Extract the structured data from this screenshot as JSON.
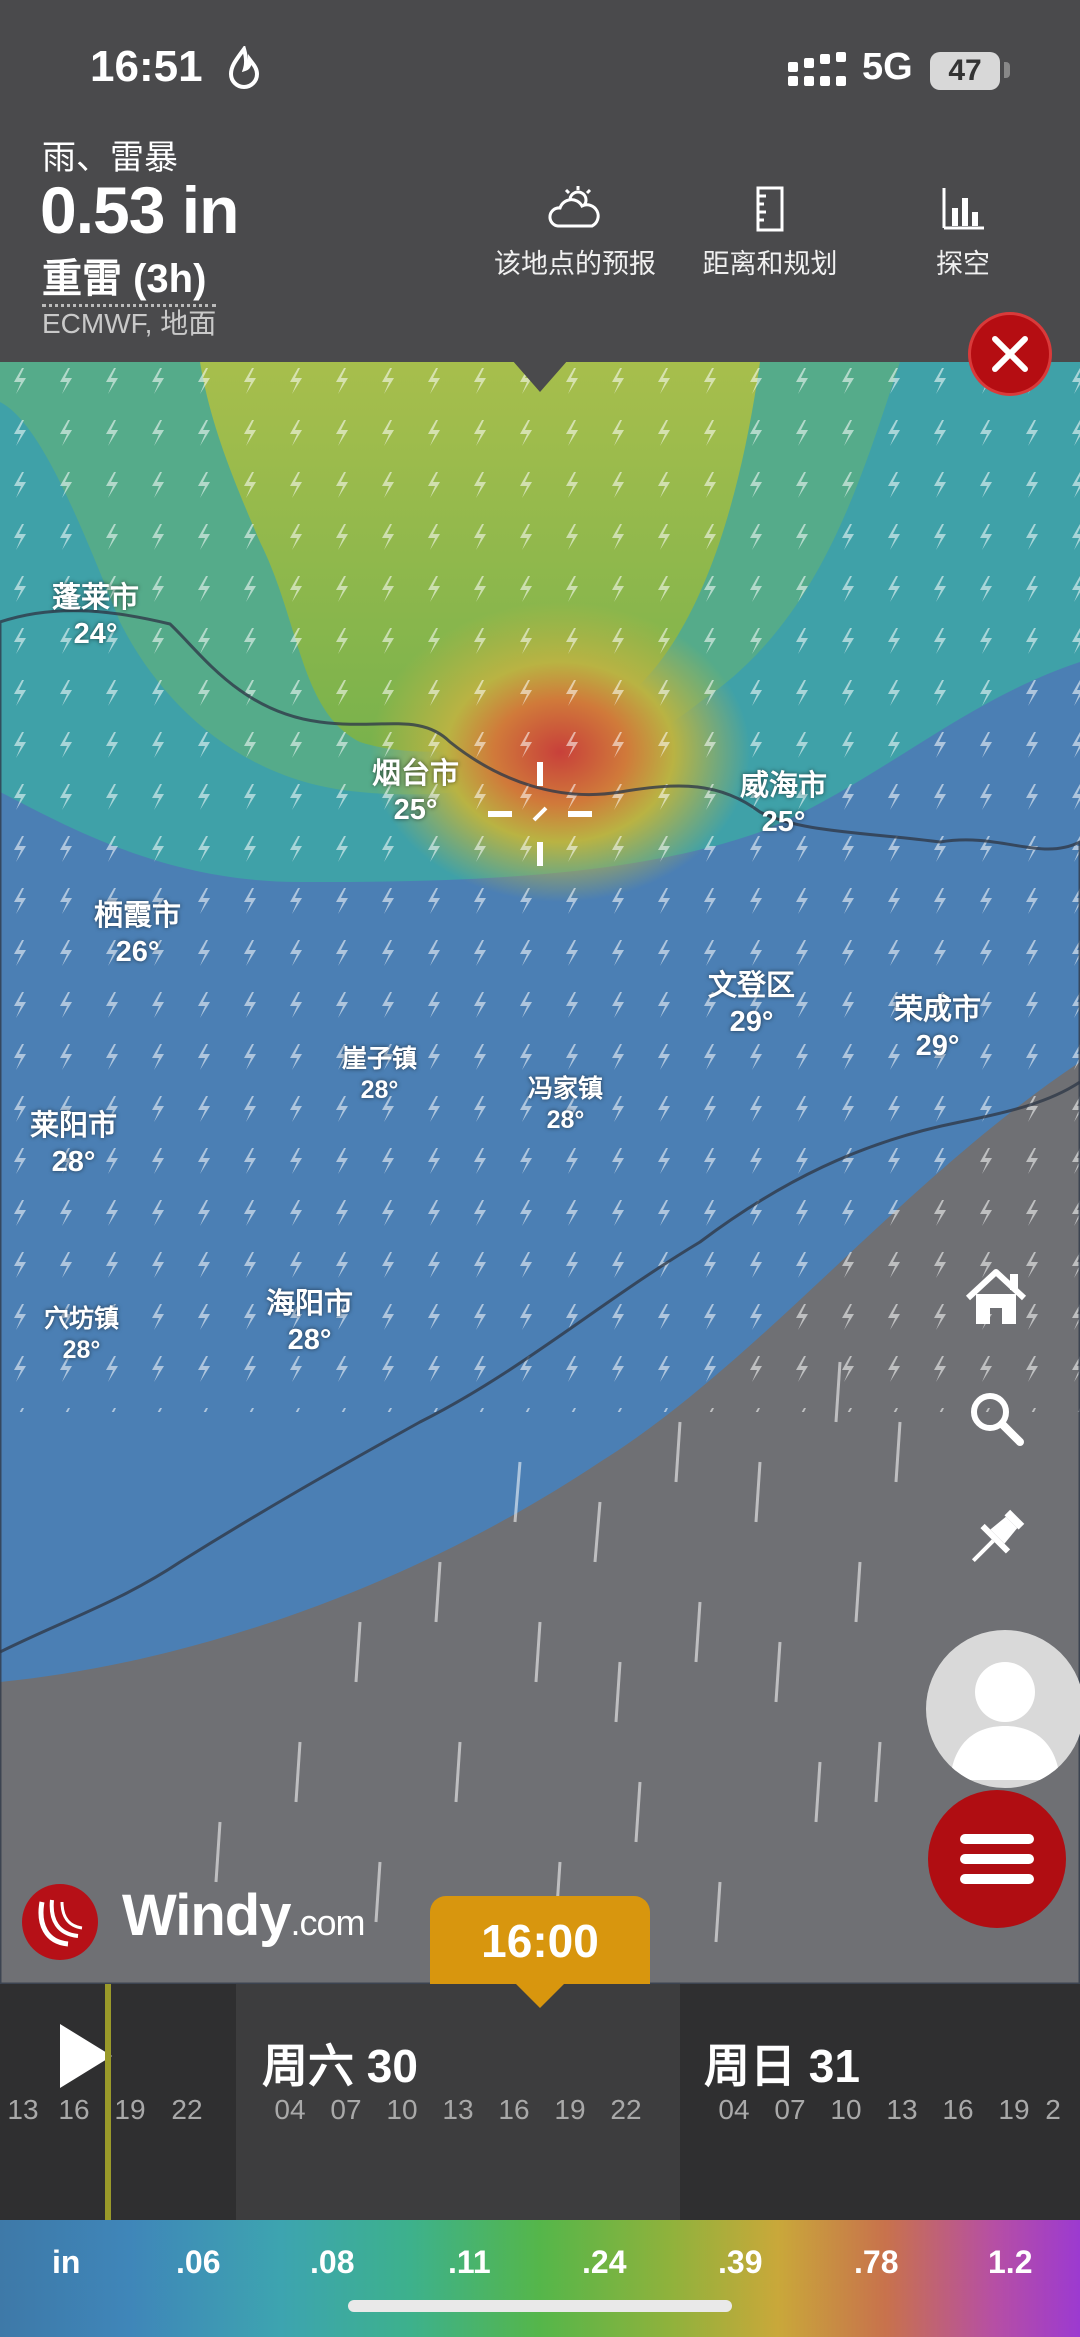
{
  "status": {
    "time": "16:51",
    "network": "5G",
    "battery": "47"
  },
  "layer": {
    "name": "雨、雷暴",
    "value": "0.53 in",
    "sub": "重雷 (3h)",
    "model": "ECMWF, 地面"
  },
  "actions": [
    {
      "label": "该地点的预报",
      "icon": "cloud-sun-icon"
    },
    {
      "label": "距离和规划",
      "icon": "ruler-icon"
    },
    {
      "label": "探空",
      "icon": "bar-chart-icon"
    }
  ],
  "cities": [
    {
      "name": "蓬莱市",
      "temp": "24°"
    },
    {
      "name": "烟台市",
      "temp": "25°"
    },
    {
      "name": "威海市",
      "temp": "25°"
    },
    {
      "name": "栖霞市",
      "temp": "26°"
    },
    {
      "name": "文登区",
      "temp": "29°"
    },
    {
      "name": "荣成市",
      "temp": "29°"
    },
    {
      "name": "崖子镇",
      "temp": "28°"
    },
    {
      "name": "冯家镇",
      "temp": "28°"
    },
    {
      "name": "莱阳市",
      "temp": "28°"
    },
    {
      "name": "穴坊镇",
      "temp": "28°"
    },
    {
      "name": "海阳市",
      "temp": "28°"
    }
  ],
  "brand": {
    "name": "Windy",
    "suffix": ".com"
  },
  "timeline": {
    "current_time": "16:00",
    "days": [
      {
        "label": "",
        "hours": [
          "13",
          "16",
          "19",
          "22"
        ]
      },
      {
        "label": "周六 30",
        "hours": [
          "04",
          "07",
          "10",
          "13",
          "16",
          "19",
          "22"
        ]
      },
      {
        "label": "周日 31",
        "hours": [
          "04",
          "07",
          "10",
          "13",
          "16",
          "19",
          "2"
        ]
      }
    ]
  },
  "legend": {
    "unit": "in",
    "stops": [
      ".06",
      ".08",
      ".11",
      ".24",
      ".39",
      ".78",
      "1.2"
    ]
  },
  "colors": {
    "accent_red": "#b00d12",
    "time_tag": "#d8960e",
    "panel": "#4a4a4c"
  }
}
